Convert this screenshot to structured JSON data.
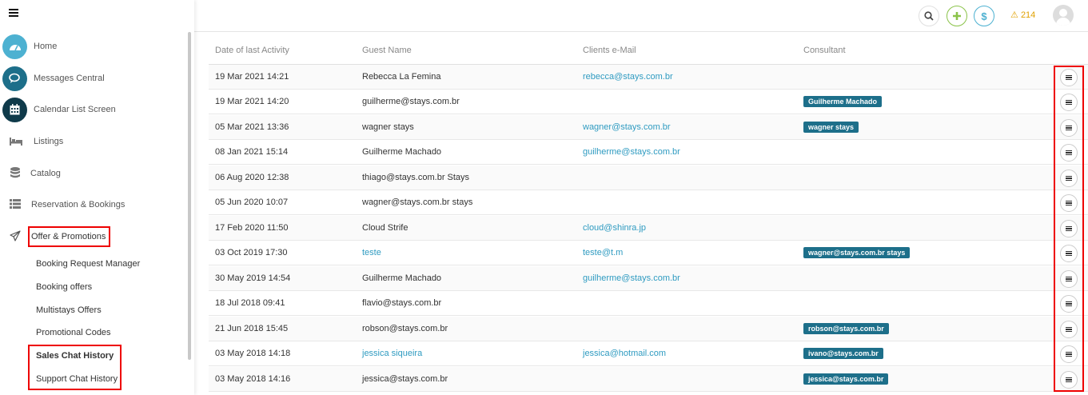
{
  "sidebar": {
    "items": [
      {
        "label": "Home",
        "icon": "dashboard-icon",
        "color": "#4db1d1"
      },
      {
        "label": "Messages Central",
        "icon": "chat-icon",
        "color": "#1d6f8a"
      },
      {
        "label": "Calendar List Screen",
        "icon": "calendar-icon",
        "color": "#0f3a4a"
      },
      {
        "label": "Listings",
        "icon": "bed-icon"
      },
      {
        "label": "Catalog",
        "icon": "database-icon"
      },
      {
        "label": "Reservation & Bookings",
        "icon": "list-icon"
      },
      {
        "label": "Offer & Promotions",
        "icon": "paper-plane-icon"
      }
    ],
    "sub_items": [
      "Booking Request Manager",
      "Booking offers",
      "Multistays Offers",
      "Promotional Codes",
      "Sales Chat History",
      "Support Chat History"
    ]
  },
  "topbar": {
    "alert_count": "214",
    "alert_icon": "warning-icon",
    "accent_green": "#8bc34a",
    "accent_blue": "#4db1d1"
  },
  "table": {
    "headers": [
      "Date of last Activity",
      "Guest Name",
      "Clients e-Mail",
      "Consultant"
    ],
    "rows": [
      {
        "date": "19 Mar 2021 14:21",
        "guest": "Rebecca La Femina",
        "email": "rebecca@stays.com.br",
        "consultant": ""
      },
      {
        "date": "19 Mar 2021 14:20",
        "guest": "guilherme@stays.com.br",
        "email": "",
        "consultant": "Guilherme Machado"
      },
      {
        "date": "05 Mar 2021 13:36",
        "guest": "wagner stays",
        "email": "wagner@stays.com.br",
        "consultant": "wagner stays"
      },
      {
        "date": "08 Jan 2021 15:14",
        "guest": "Guilherme Machado",
        "email": "guilherme@stays.com.br",
        "consultant": ""
      },
      {
        "date": "06 Aug 2020 12:38",
        "guest": "thiago@stays.com.br Stays",
        "email": "",
        "consultant": ""
      },
      {
        "date": "05 Jun 2020 10:07",
        "guest": "wagner@stays.com.br stays",
        "email": "",
        "consultant": ""
      },
      {
        "date": "17 Feb 2020 11:50",
        "guest": "Cloud Strife",
        "email": "cloud@shinra.jp",
        "consultant": ""
      },
      {
        "date": "03 Oct 2019 17:30",
        "guest": "teste",
        "guest_link": true,
        "email": "teste@t.m",
        "consultant": "wagner@stays.com.br stays"
      },
      {
        "date": "30 May 2019 14:54",
        "guest": "Guilherme Machado",
        "email": "guilherme@stays.com.br",
        "consultant": ""
      },
      {
        "date": "18 Jul 2018 09:41",
        "guest": "flavio@stays.com.br",
        "email": "",
        "consultant": ""
      },
      {
        "date": "21 Jun 2018 15:45",
        "guest": "robson@stays.com.br",
        "email": "",
        "consultant": "robson@stays.com.br"
      },
      {
        "date": "03 May 2018 14:18",
        "guest": "jessica siqueira",
        "guest_link": true,
        "email": "jessica@hotmail.com",
        "consultant": "ivano@stays.com.br"
      },
      {
        "date": "03 May 2018 14:16",
        "guest": "jessica@stays.com.br",
        "email": "",
        "consultant": "jessica@stays.com.br"
      }
    ]
  }
}
